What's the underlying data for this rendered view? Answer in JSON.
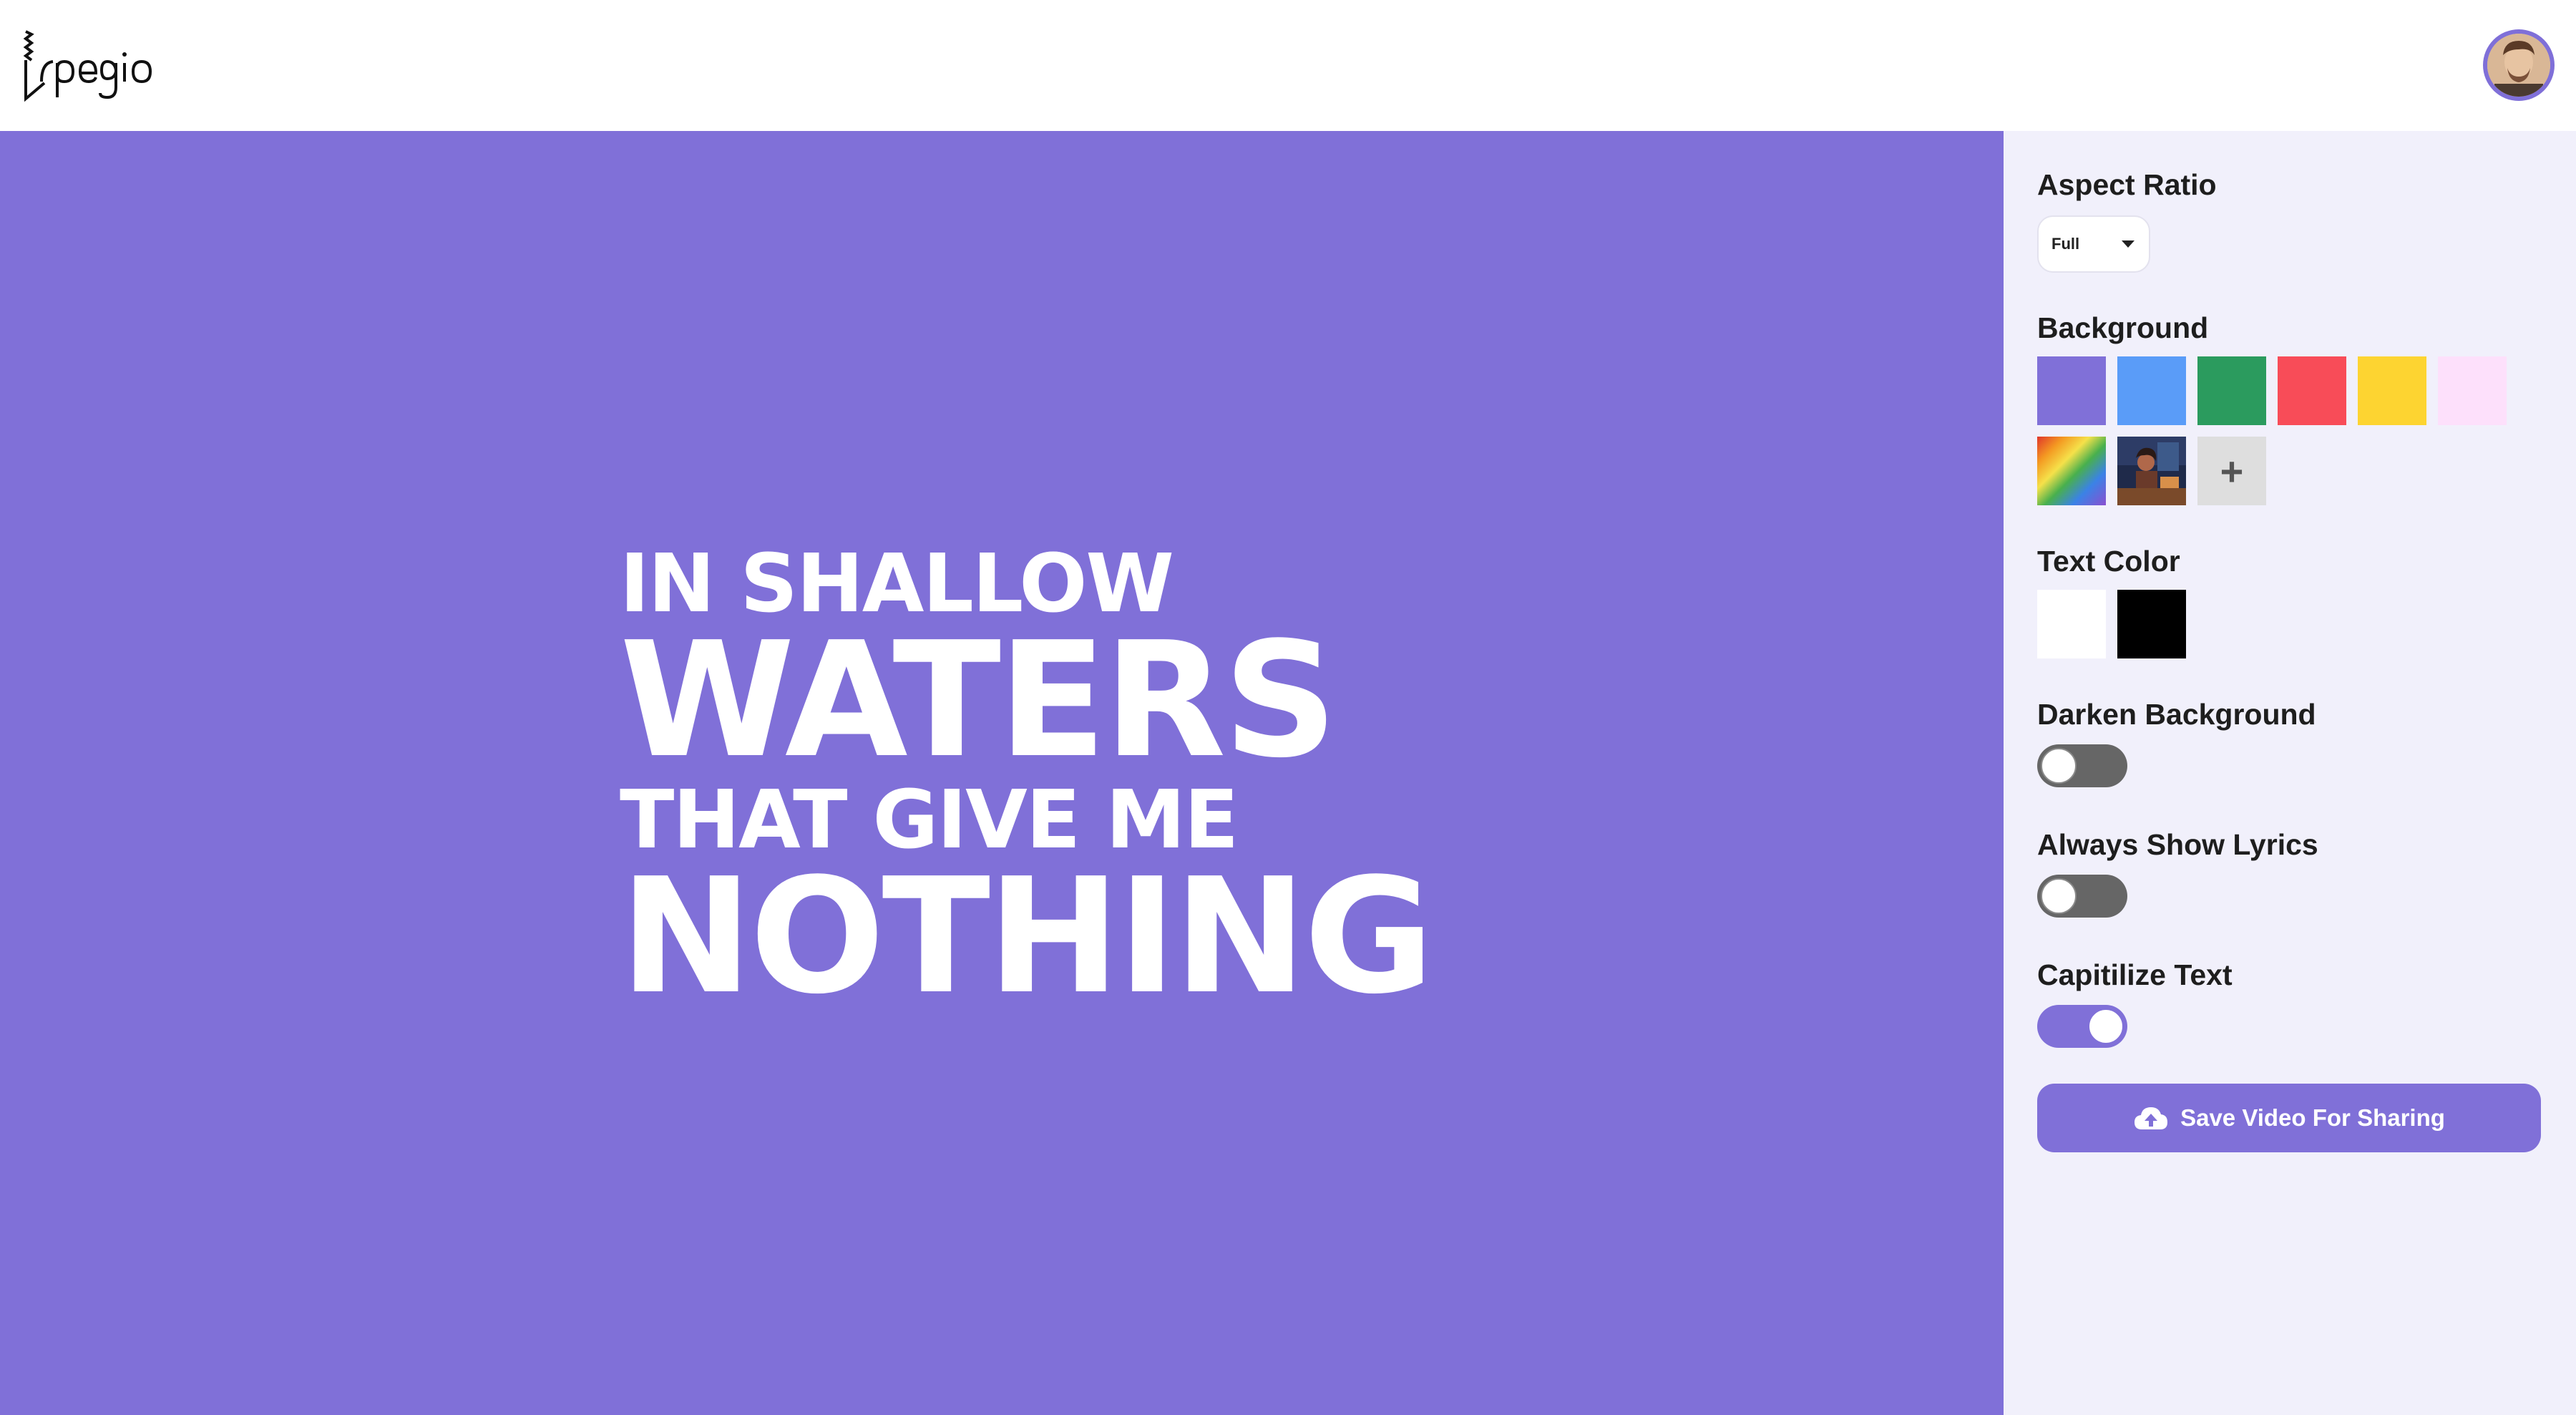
{
  "app": {
    "logo_text": "Irpegio"
  },
  "user": {
    "avatar_alt": "User avatar"
  },
  "lyrics": {
    "lines": [
      "IN SHALLOW",
      "WATERS",
      "THAT GIVE ME",
      "NOTHING"
    ]
  },
  "sidebar": {
    "aspect_ratio": {
      "title": "Aspect Ratio",
      "selected": "Full"
    },
    "background": {
      "title": "Background",
      "swatches": [
        {
          "name": "purple",
          "color": "#8070d8"
        },
        {
          "name": "blue",
          "color": "#5a9cf8"
        },
        {
          "name": "green",
          "color": "#2b9b5e"
        },
        {
          "name": "red",
          "color": "#f84c58"
        },
        {
          "name": "yellow",
          "color": "#fdd431"
        },
        {
          "name": "pink",
          "color": "#fde0fb"
        },
        {
          "name": "rainbow",
          "color": "gradient"
        },
        {
          "name": "image",
          "color": "photo"
        }
      ],
      "add_label": "+"
    },
    "text_color": {
      "title": "Text Color",
      "swatches": [
        {
          "name": "white",
          "color": "#ffffff"
        },
        {
          "name": "black",
          "color": "#000000"
        }
      ]
    },
    "darken_background": {
      "title": "Darken Background",
      "on": false
    },
    "always_show_lyrics": {
      "title": "Always Show Lyrics",
      "on": false
    },
    "capitalize_text": {
      "title": "Capitilize Text",
      "on": true
    },
    "save_button": {
      "label": "Save Video For Sharing",
      "icon": "cloud-upload-icon"
    }
  },
  "colors": {
    "accent": "#8070d8",
    "sidebar_bg": "#f1f0fb",
    "toggle_off": "#666666"
  }
}
